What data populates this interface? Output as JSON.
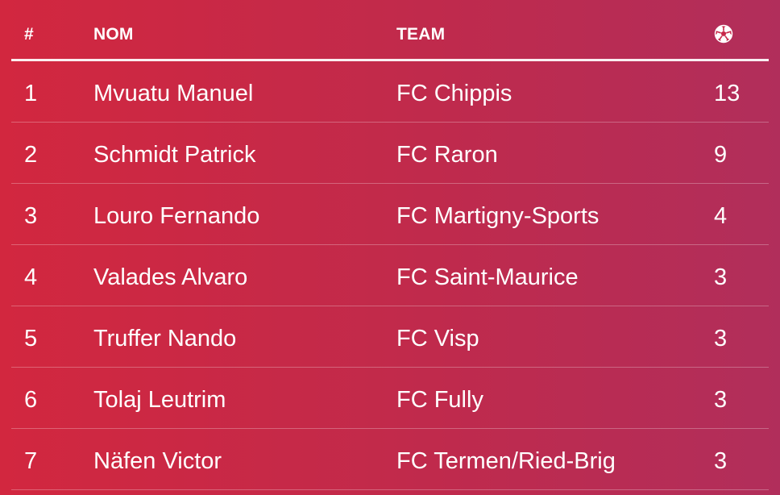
{
  "table": {
    "headers": {
      "rank": "#",
      "name": "NOM",
      "team": "TEAM",
      "goals_icon": "soccer-ball-icon"
    },
    "rows": [
      {
        "rank": "1",
        "name": "Mvuatu Manuel",
        "team": "FC Chippis",
        "goals": "13"
      },
      {
        "rank": "2",
        "name": "Schmidt Patrick",
        "team": "FC Raron",
        "goals": "9"
      },
      {
        "rank": "3",
        "name": "Louro Fernando",
        "team": "FC Martigny-Sports",
        "goals": "4"
      },
      {
        "rank": "4",
        "name": "Valades Alvaro",
        "team": "FC Saint-Maurice",
        "goals": "3"
      },
      {
        "rank": "5",
        "name": "Truffer Nando",
        "team": "FC Visp",
        "goals": "3"
      },
      {
        "rank": "6",
        "name": "Tolaj Leutrim",
        "team": "FC Fully",
        "goals": "3"
      },
      {
        "rank": "7",
        "name": "Näfen Victor",
        "team": "FC Termen/Ried-Brig",
        "goals": "3"
      }
    ]
  },
  "colors": {
    "background_start": "#d2273f",
    "background_end": "#b12e5b",
    "text": "#ffffff"
  }
}
